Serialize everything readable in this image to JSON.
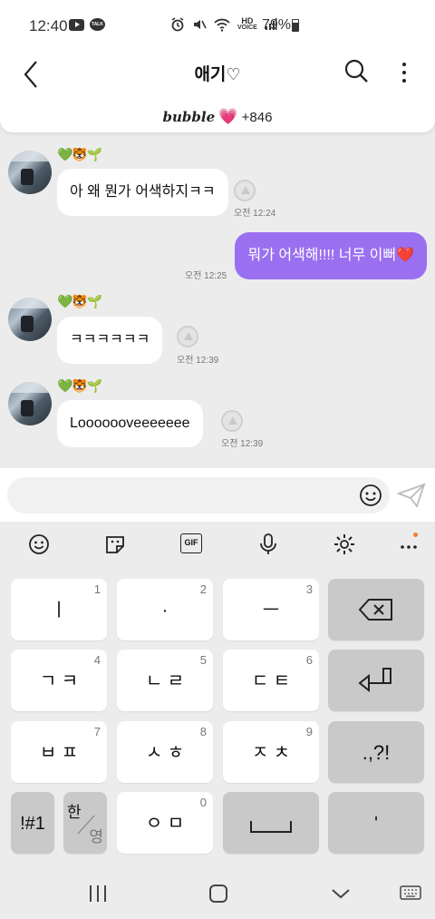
{
  "status_bar": {
    "time": "12:40",
    "talk_badge": "TALK",
    "hd_label": "HD",
    "voice_label": "VOICE",
    "battery": "79%"
  },
  "header": {
    "title": "애기",
    "heart_glyph": "♡"
  },
  "subheader": {
    "brand": "bubble",
    "heart": "💗",
    "count": "+846"
  },
  "messages": [
    {
      "sender_emojis": "💚🐯🌱",
      "text": "아 왜 뭔가 어색하지ㅋㅋ",
      "time": "오전 12:24"
    },
    {
      "text": "뭐가 어색해!!!! 너무 이뻐❤️",
      "time": "오전 12:25",
      "mine": true
    },
    {
      "sender_emojis": "💚🐯🌱",
      "text": "ㅋㅋㅋㅋㅋㅋ",
      "time": "오전 12:39"
    },
    {
      "sender_emojis": "💚🐯🌱",
      "text": "Looooooveeeeeee",
      "time": "오전 12:39"
    }
  ],
  "input": {
    "placeholder": ""
  },
  "keyboard": {
    "toolbar": [
      "emoji-icon",
      "sticker-icon",
      "gif-icon",
      "mic-icon",
      "settings-icon",
      "more-icon"
    ],
    "gif_label": "GIF",
    "rows": [
      [
        {
          "label": "ㅣ",
          "num": "1"
        },
        {
          "label": "·",
          "num": "2"
        },
        {
          "label": "ㅡ",
          "num": "3"
        },
        {
          "label": "",
          "num": "",
          "icon": "backspace-icon"
        }
      ],
      [
        {
          "label": "ㄱ ㅋ",
          "num": "4"
        },
        {
          "label": "ㄴ ㄹ",
          "num": "5"
        },
        {
          "label": "ㄷ ㅌ",
          "num": "6"
        },
        {
          "label": "",
          "num": "",
          "icon": "enter-icon"
        }
      ],
      [
        {
          "label": "ㅂ ㅍ",
          "num": "7"
        },
        {
          "label": "ㅅ ㅎ",
          "num": "8"
        },
        {
          "label": "ㅈ ㅊ",
          "num": "9"
        },
        {
          "label": ".,?!",
          "num": ""
        }
      ],
      [
        {
          "label": "!#1",
          "num": ""
        },
        {
          "label_top": "한",
          "label_bottom": "영"
        },
        {
          "label": "ㅇ ㅁ",
          "num": "0"
        },
        {
          "label": "",
          "icon": "space-icon"
        },
        {
          "label": "'",
          "num": ""
        }
      ]
    ]
  },
  "nav_bar": [
    "recents-icon",
    "home-icon",
    "back-icon",
    "keyboard-icon"
  ]
}
